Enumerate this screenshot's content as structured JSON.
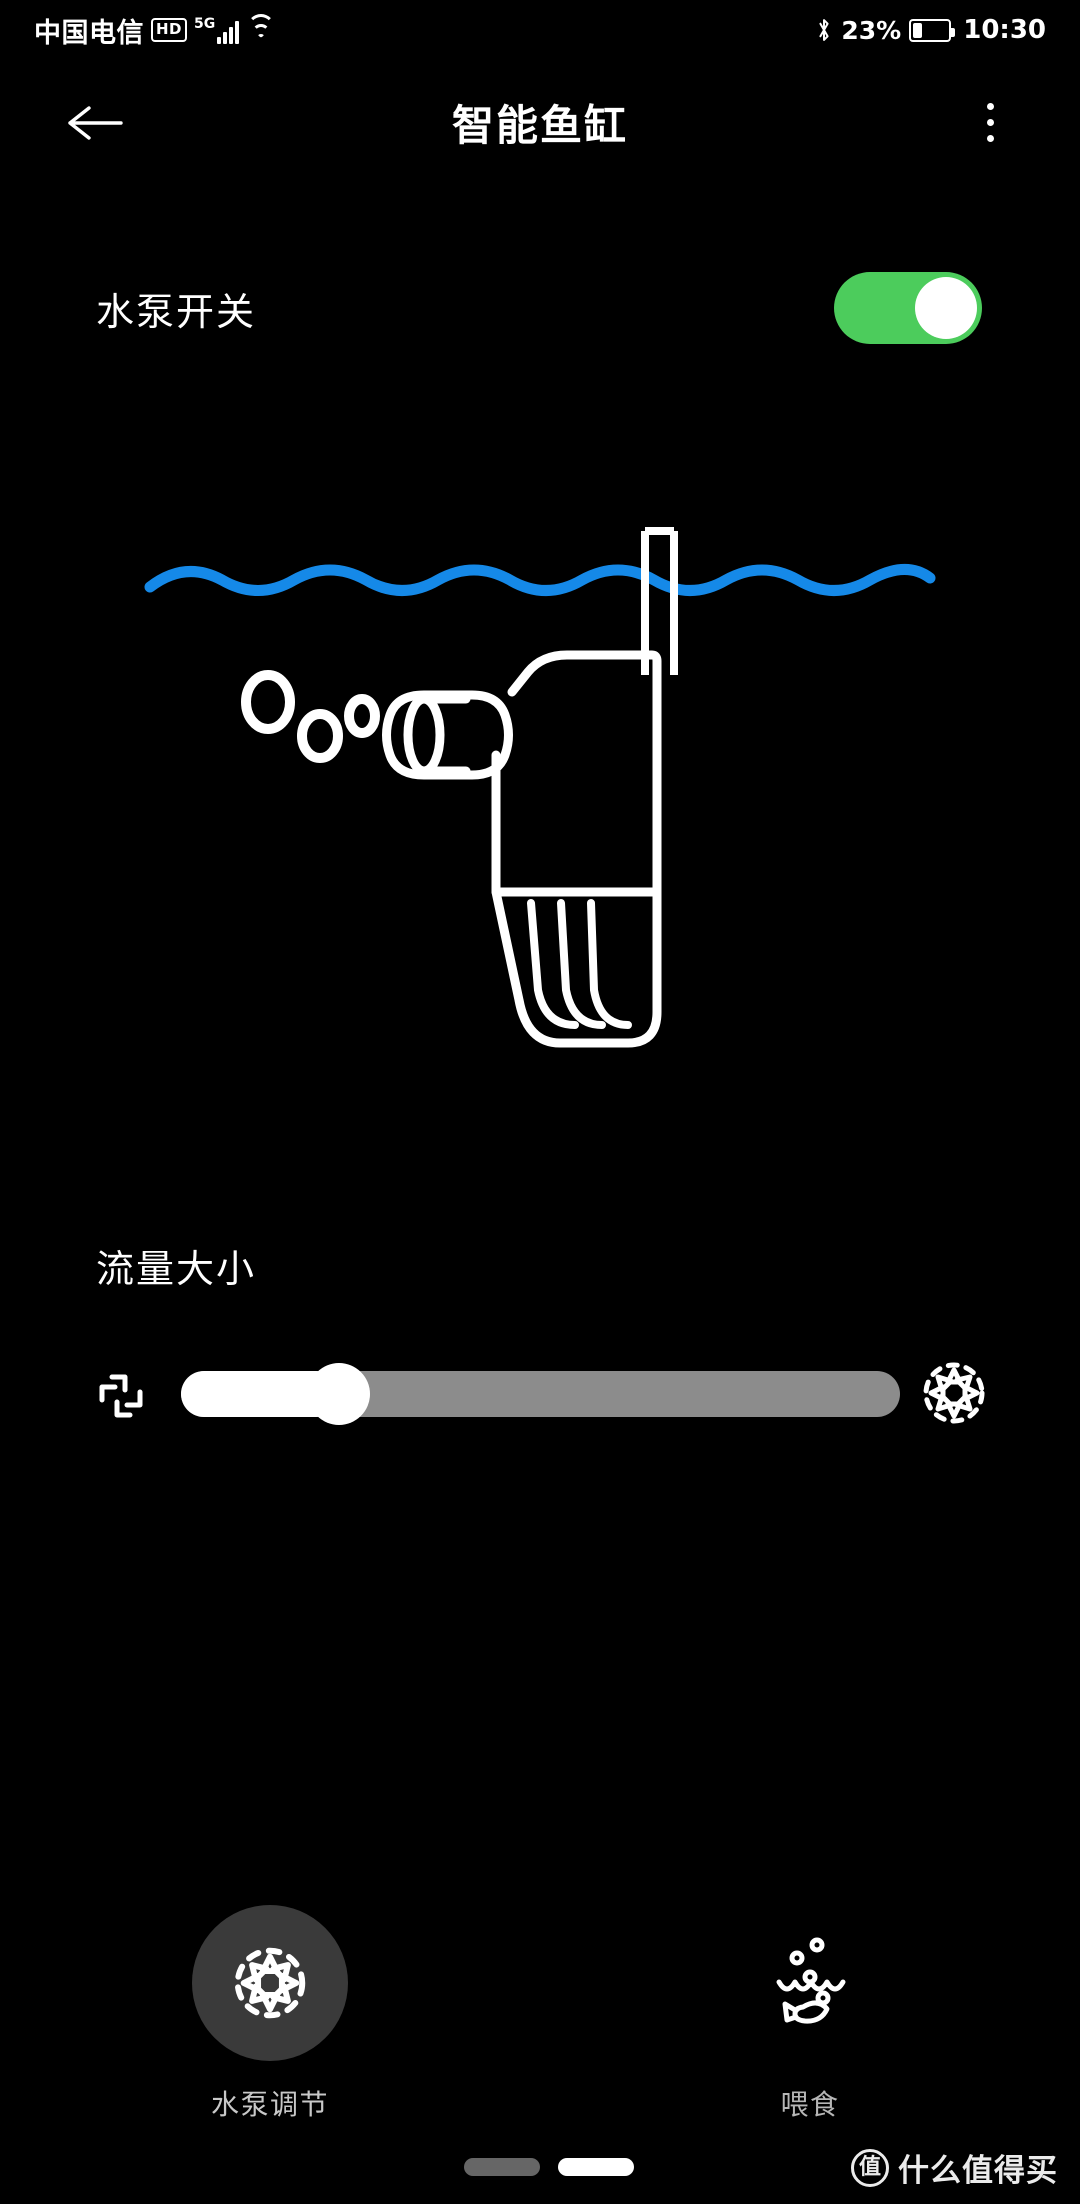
{
  "status_bar": {
    "carrier": "中国电信",
    "hd_badge": "HD",
    "network_type": "5G",
    "bluetooth_icon": "bluetooth-icon",
    "wifi_icon": "wifi-icon",
    "signal_icon": "signal-bars-icon",
    "battery_percent": "23%",
    "battery_level": 23,
    "clock": "10:30"
  },
  "app_bar": {
    "back_icon": "back-arrow-icon",
    "title": "智能鱼缸",
    "overflow_icon": "more-vertical-icon"
  },
  "pump_switch": {
    "label": "水泵开关",
    "state": "on",
    "accent_color": "#4ccc5c"
  },
  "illustration": {
    "name": "aquarium-pump-illustration",
    "water_line_color": "#1589e8",
    "outline_color": "#ffffff",
    "bubbles": 3
  },
  "flow": {
    "label": "流量大小",
    "min_icon": "fan-low-icon",
    "max_icon": "fan-high-icon",
    "value_percent": 22
  },
  "actions": [
    {
      "label": "水泵调节",
      "icon": "impeller-icon",
      "active": true
    },
    {
      "label": "喂食",
      "icon": "fish-feed-icon",
      "active": false
    }
  ],
  "nav_bar": {
    "recents_pill": "nav-pill-left",
    "home_pill": "nav-pill-right"
  },
  "watermark": {
    "logo_char": "值",
    "text": "什么值得买"
  }
}
